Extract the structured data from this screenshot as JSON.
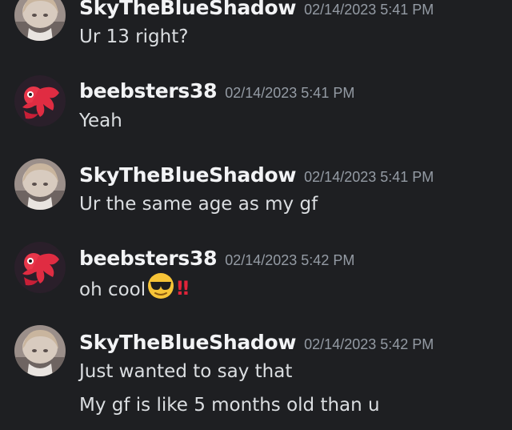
{
  "messages": [
    {
      "username": "SkyTheBlueShadow",
      "timestamp": "02/14/2023 5:41 PM",
      "avatar": "sky-avatar",
      "lines": [
        "Ur 13 right?"
      ]
    },
    {
      "username": "beebsters38",
      "timestamp": "02/14/2023 5:41 PM",
      "avatar": "beeb-avatar",
      "lines": [
        "Yeah"
      ]
    },
    {
      "username": "SkyTheBlueShadow",
      "timestamp": "02/14/2023 5:41 PM",
      "avatar": "sky-avatar",
      "lines": [
        "Ur the same age as my gf"
      ]
    },
    {
      "username": "beebsters38",
      "timestamp": "02/14/2023 5:42 PM",
      "avatar": "beeb-avatar",
      "lines": [
        "oh cool"
      ],
      "emojis": [
        "sunglasses-emoji",
        "double-exclamation-emoji"
      ],
      "emoji_text": "‼"
    },
    {
      "username": "SkyTheBlueShadow",
      "timestamp": "02/14/2023 5:42 PM",
      "avatar": "sky-avatar",
      "lines": [
        "Just wanted to say that",
        "My gf is like 5 months old than u"
      ]
    }
  ],
  "colors": {
    "background": "#1e1f22",
    "username": "#f2f3f5",
    "timestamp": "#949ba4",
    "message_text": "#dbdee1",
    "bangbang": "#e0243a"
  }
}
